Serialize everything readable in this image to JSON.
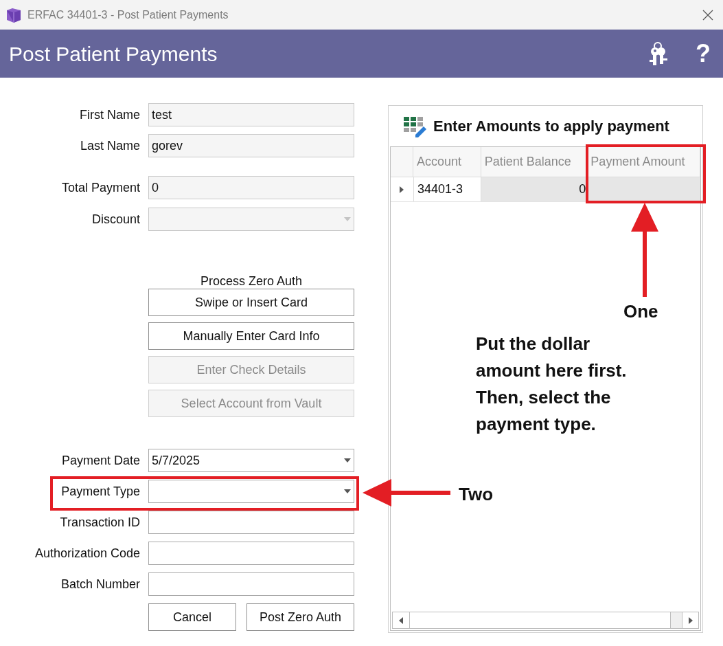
{
  "window": {
    "title": "ERFAC 34401-3 - Post Patient Payments"
  },
  "header": {
    "title": "Post Patient Payments",
    "help": "?"
  },
  "top_fields": [
    {
      "label": "First Name",
      "kind": "text",
      "value": "test",
      "disabled": true
    },
    {
      "label": "Last Name",
      "kind": "text",
      "value": "gorev",
      "disabled": true
    },
    {
      "label": "Total Payment",
      "kind": "text",
      "value": "0",
      "disabled": true
    },
    {
      "label": "Discount",
      "kind": "dropdown",
      "disabled": true
    }
  ],
  "zero_auth": {
    "title": "Process Zero Auth",
    "buttons": [
      {
        "label": "Swipe or Insert Card",
        "disabled": false
      },
      {
        "label": "Manually Enter Card Info",
        "disabled": false
      },
      {
        "label": "Enter Check Details",
        "disabled": true
      },
      {
        "label": "Select Account from Vault",
        "disabled": true
      }
    ]
  },
  "bottom_fields": [
    {
      "label": "Payment Date",
      "kind": "dropdown",
      "value": "5/7/2025",
      "disabled": false
    },
    {
      "label": "Payment Type",
      "kind": "dropdown",
      "disabled": false
    },
    {
      "label": "Transaction ID",
      "kind": "text",
      "disabled": false
    },
    {
      "label": "Authorization Code",
      "kind": "text",
      "disabled": false
    },
    {
      "label": "Batch Number",
      "kind": "text",
      "disabled": false
    }
  ],
  "actions": [
    {
      "label": "Cancel"
    },
    {
      "label": "Post Zero Auth"
    }
  ],
  "grid": {
    "title": "Enter Amounts to apply payment",
    "columns": [
      "Account",
      "Patient Balance",
      "Payment Amount"
    ],
    "rows": [
      {
        "account": "34401-3",
        "patient_balance": "0",
        "selected": true
      }
    ]
  },
  "annotations": {
    "one": "One",
    "note": "Put the dollar amount here first. Then, select the payment type.",
    "two": "Two"
  }
}
